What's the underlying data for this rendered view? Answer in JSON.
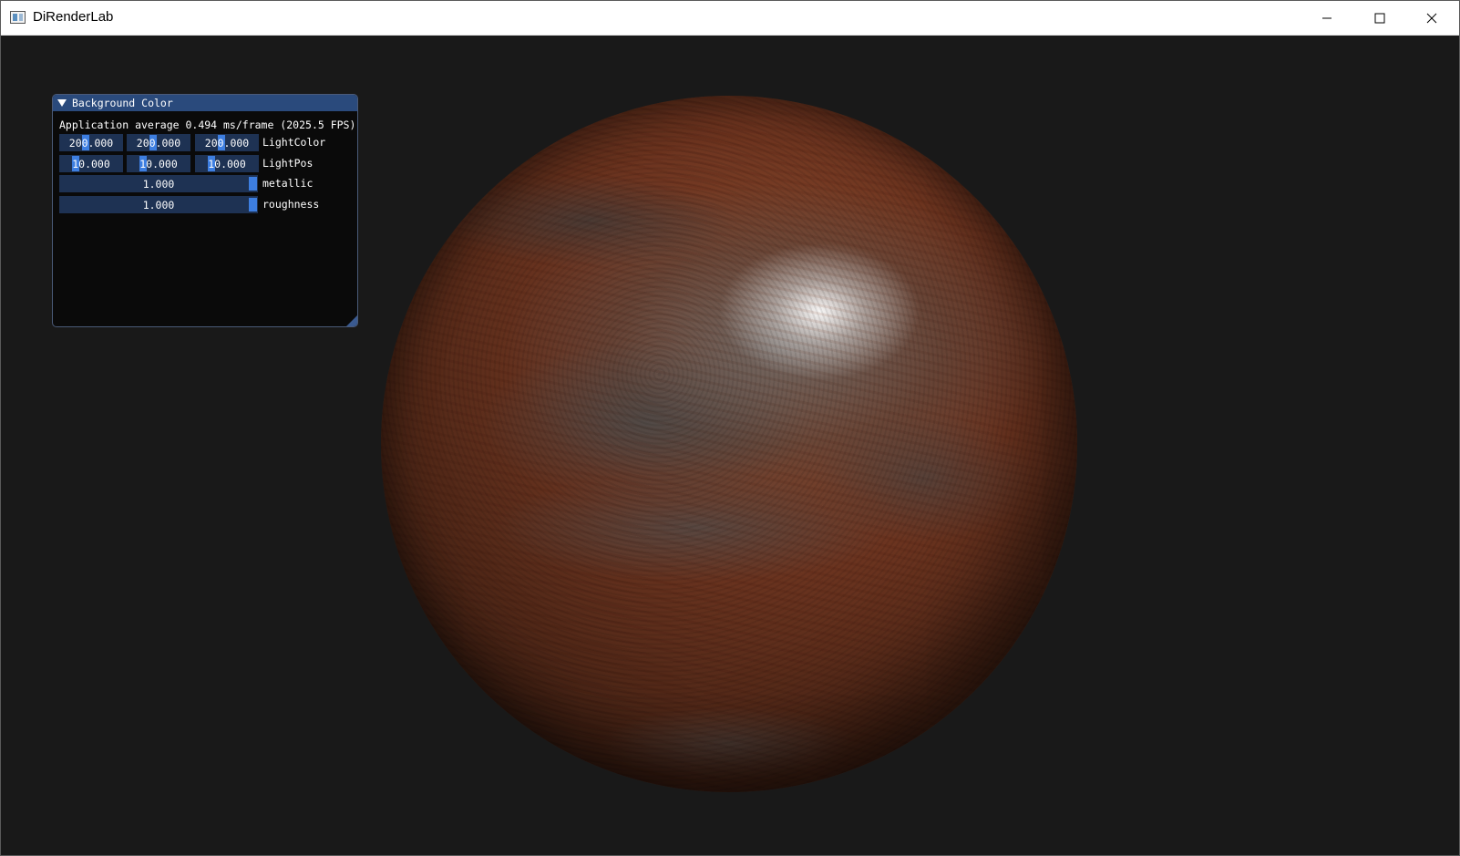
{
  "window": {
    "title": "DiRenderLab",
    "icon": "app-icon",
    "controls": [
      "minimize-icon",
      "maximize-icon",
      "close-icon"
    ]
  },
  "viewport": {
    "background_color": "#191919",
    "object": "rusted-metal-sphere"
  },
  "panel": {
    "title": "Background Color",
    "stats": "Application average 0.494 ms/frame (2025.5 FPS)",
    "light_color": {
      "label": "LightColor",
      "values": [
        "200.000",
        "200.000",
        "200.000"
      ]
    },
    "light_pos": {
      "label": "LightPos",
      "values": [
        "10.000",
        "10.000",
        "10.000"
      ]
    },
    "metallic": {
      "label": "metallic",
      "value": "1.000"
    },
    "roughness": {
      "label": "roughness",
      "value": "1.000"
    },
    "colors": {
      "header": "#2a4a7c",
      "frame": "#1e3253",
      "accent": "#3d7ee0"
    }
  }
}
